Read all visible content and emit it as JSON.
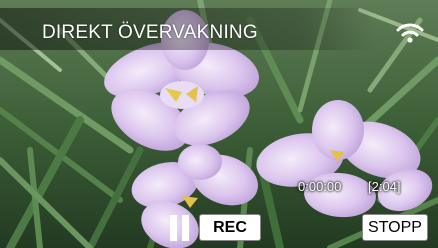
{
  "header": {
    "title": "DIREKT ÖVERVAKNING",
    "connection_icon": "wifi-icon"
  },
  "playback": {
    "elapsed": "0:00:00",
    "remaining": "[2:04]"
  },
  "controls": {
    "pause_icon": "pause-icon",
    "rec_label": "REC",
    "stop_label": "STOPP"
  },
  "colors": {
    "button_bg": "#ffffff",
    "text": "#ffffff",
    "petal": "#ddc6ee",
    "leaf": "#3f7a3a"
  }
}
